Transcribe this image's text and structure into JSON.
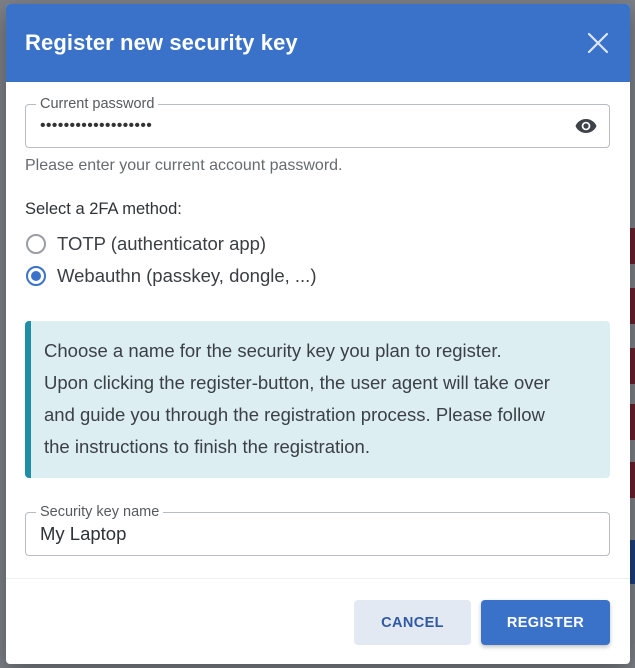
{
  "dialog": {
    "title": "Register new security key",
    "close_icon": "close-icon"
  },
  "password": {
    "label": "Current password",
    "value": "•••••••••••••••••••",
    "toggle_icon": "eye-icon",
    "helper": "Please enter your current account password."
  },
  "method": {
    "label": "Select a 2FA method:",
    "options": [
      {
        "label": "TOTP (authenticator app)",
        "checked": false
      },
      {
        "label": "Webauthn (passkey, dongle, ...)",
        "checked": true
      }
    ]
  },
  "info": {
    "lines": [
      "Choose a name for the security key you plan to register.",
      "Upon clicking the register-button, the user agent will take over",
      "and guide you through the registration process. Please follow",
      "the instructions to finish the registration."
    ]
  },
  "key_name": {
    "label": "Security key name",
    "value": "My Laptop"
  },
  "footer": {
    "cancel_label": "CANCEL",
    "register_label": "REGISTER"
  },
  "colors": {
    "primary": "#3b72c9",
    "info_bg": "#ddeef3",
    "info_border": "#1f8fa8"
  }
}
